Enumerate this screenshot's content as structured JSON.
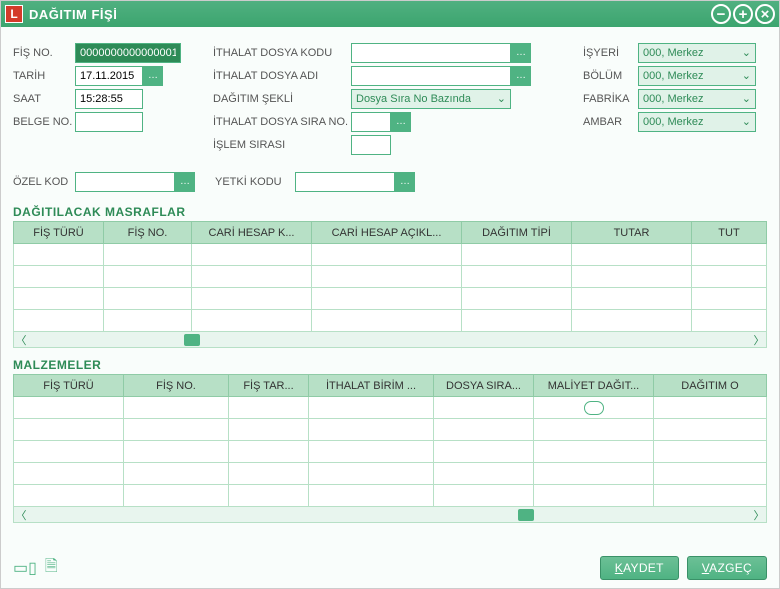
{
  "title": "DAĞITIM FİŞİ",
  "title_icon_letter": "L",
  "left": {
    "fis_no_label": "FİŞ NO.",
    "fis_no_value": "0000000000000001",
    "tarih_label": "TARİH",
    "tarih_value": "17.11.2015",
    "saat_label": "SAAT",
    "saat_value": "15:28:55",
    "belge_no_label": "BELGE NO.",
    "belge_no_value": ""
  },
  "mid": {
    "dosya_kodu_label": "İTHALAT DOSYA KODU",
    "dosya_kodu_value": "",
    "dosya_adi_label": "İTHALAT DOSYA ADI",
    "dosya_adi_value": "",
    "dagitim_sekli_label": "DAĞITIM ŞEKLİ",
    "dagitim_sekli_value": "Dosya Sıra No Bazında",
    "sira_no_label": "İTHALAT DOSYA SIRA NO.",
    "sira_no_value": "",
    "islem_sirasi_label": "İŞLEM SIRASI",
    "islem_sirasi_value": ""
  },
  "right": {
    "isyeri_label": "İŞYERİ",
    "isyeri_value": "000, Merkez",
    "bolum_label": "BÖLÜM",
    "bolum_value": "000, Merkez",
    "fabrika_label": "FABRİKA",
    "fabrika_value": "000, Merkez",
    "ambar_label": "AMBAR",
    "ambar_value": "000, Merkez"
  },
  "ozel_kod_label": "ÖZEL KOD",
  "ozel_kod_value": "",
  "yetki_kodu_label": "YETKİ KODU",
  "yetki_kodu_value": "",
  "grid1": {
    "title": "DAĞITILACAK MASRAFLAR",
    "headers": [
      "FİŞ TÜRÜ",
      "FİŞ NO.",
      "CARİ HESAP K...",
      "CARİ HESAP AÇIKL...",
      "DAĞITIM TİPİ",
      "TUTAR",
      "TUT"
    ]
  },
  "grid2": {
    "title": "MALZEMELER",
    "headers": [
      "FİŞ TÜRÜ",
      "FİŞ NO.",
      "FİŞ TAR...",
      "İTHALAT BİRİM ...",
      "DOSYA SIRA...",
      "MALİYET DAĞIT...",
      "DAĞITIM O"
    ]
  },
  "footer": {
    "kaydet": "KAYDET",
    "vazgec": "VAZGEÇ"
  }
}
